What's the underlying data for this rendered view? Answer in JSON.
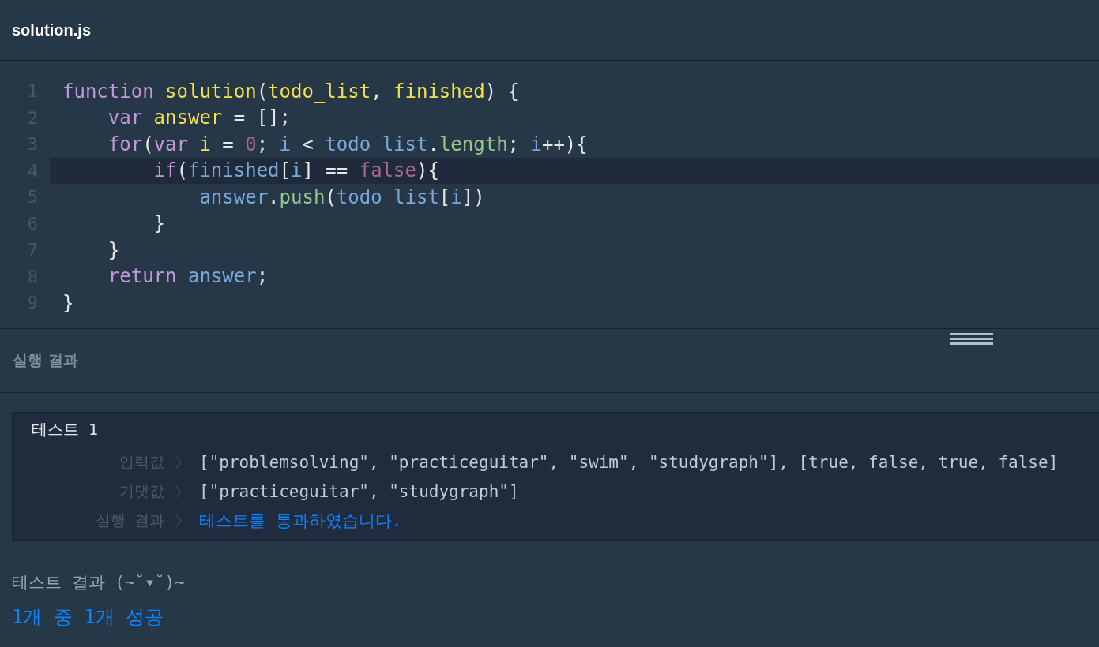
{
  "file_tab": {
    "title": "solution.js"
  },
  "editor": {
    "lines": [
      {
        "number": "1",
        "highlighted": false,
        "tokens": [
          {
            "kind": "keyword",
            "text": "function"
          },
          {
            "kind": "name",
            "text": " solution"
          },
          {
            "kind": "plain",
            "text": "("
          },
          {
            "kind": "name",
            "text": "todo_list"
          },
          {
            "kind": "plain",
            "text": ", "
          },
          {
            "kind": "name",
            "text": "finished"
          },
          {
            "kind": "plain",
            "text": ") {"
          }
        ]
      },
      {
        "number": "2",
        "highlighted": false,
        "tokens": [
          {
            "kind": "keyword",
            "text": "    var"
          },
          {
            "kind": "name",
            "text": " answer"
          },
          {
            "kind": "plain",
            "text": " = [];"
          }
        ]
      },
      {
        "number": "3",
        "highlighted": false,
        "tokens": [
          {
            "kind": "keyword",
            "text": "    for"
          },
          {
            "kind": "plain",
            "text": "("
          },
          {
            "kind": "keyword",
            "text": "var"
          },
          {
            "kind": "name",
            "text": " i"
          },
          {
            "kind": "plain",
            "text": " = "
          },
          {
            "kind": "literal",
            "text": "0"
          },
          {
            "kind": "plain",
            "text": "; "
          },
          {
            "kind": "variable",
            "text": "i"
          },
          {
            "kind": "plain",
            "text": " < "
          },
          {
            "kind": "variable",
            "text": "todo_list"
          },
          {
            "kind": "plain",
            "text": "."
          },
          {
            "kind": "property",
            "text": "length"
          },
          {
            "kind": "plain",
            "text": "; "
          },
          {
            "kind": "variable",
            "text": "i"
          },
          {
            "kind": "plain",
            "text": "++){"
          }
        ]
      },
      {
        "number": "4",
        "highlighted": true,
        "tokens": [
          {
            "kind": "keyword",
            "text": "        if"
          },
          {
            "kind": "plain",
            "text": "("
          },
          {
            "kind": "variable",
            "text": "finished"
          },
          {
            "kind": "plain",
            "text": "["
          },
          {
            "kind": "variable",
            "text": "i"
          },
          {
            "kind": "plain",
            "text": "] == "
          },
          {
            "kind": "literal",
            "text": "false"
          },
          {
            "kind": "plain",
            "text": "){"
          }
        ]
      },
      {
        "number": "5",
        "highlighted": false,
        "tokens": [
          {
            "kind": "variable",
            "text": "            answer"
          },
          {
            "kind": "plain",
            "text": "."
          },
          {
            "kind": "property",
            "text": "push"
          },
          {
            "kind": "plain",
            "text": "("
          },
          {
            "kind": "variable",
            "text": "todo_list"
          },
          {
            "kind": "plain",
            "text": "["
          },
          {
            "kind": "variable",
            "text": "i"
          },
          {
            "kind": "plain",
            "text": "])"
          }
        ]
      },
      {
        "number": "6",
        "highlighted": false,
        "tokens": [
          {
            "kind": "plain",
            "text": "        }"
          }
        ]
      },
      {
        "number": "7",
        "highlighted": false,
        "tokens": [
          {
            "kind": "plain",
            "text": "    }"
          }
        ]
      },
      {
        "number": "8",
        "highlighted": false,
        "tokens": [
          {
            "kind": "keyword",
            "text": "    return"
          },
          {
            "kind": "variable",
            "text": " answer"
          },
          {
            "kind": "plain",
            "text": ";"
          }
        ]
      },
      {
        "number": "9",
        "highlighted": false,
        "tokens": [
          {
            "kind": "plain",
            "text": "}"
          }
        ]
      }
    ]
  },
  "results_panel": {
    "title": "실행 결과",
    "tests": [
      {
        "title": "테스트 1",
        "rows": [
          {
            "label": "입력값",
            "value": "[\"problemsolving\", \"practiceguitar\", \"swim\", \"studygraph\"], [true, false, true, false]",
            "passed": false
          },
          {
            "label": "기댓값",
            "value": "[\"practiceguitar\", \"studygraph\"]",
            "passed": false
          },
          {
            "label": "실행 결과",
            "value": "테스트를 통과하였습니다.",
            "passed": true
          }
        ]
      }
    ],
    "summary_title": "테스트 결과 (~˘▾˘)~",
    "summary": "1개 중 1개 성공"
  }
}
